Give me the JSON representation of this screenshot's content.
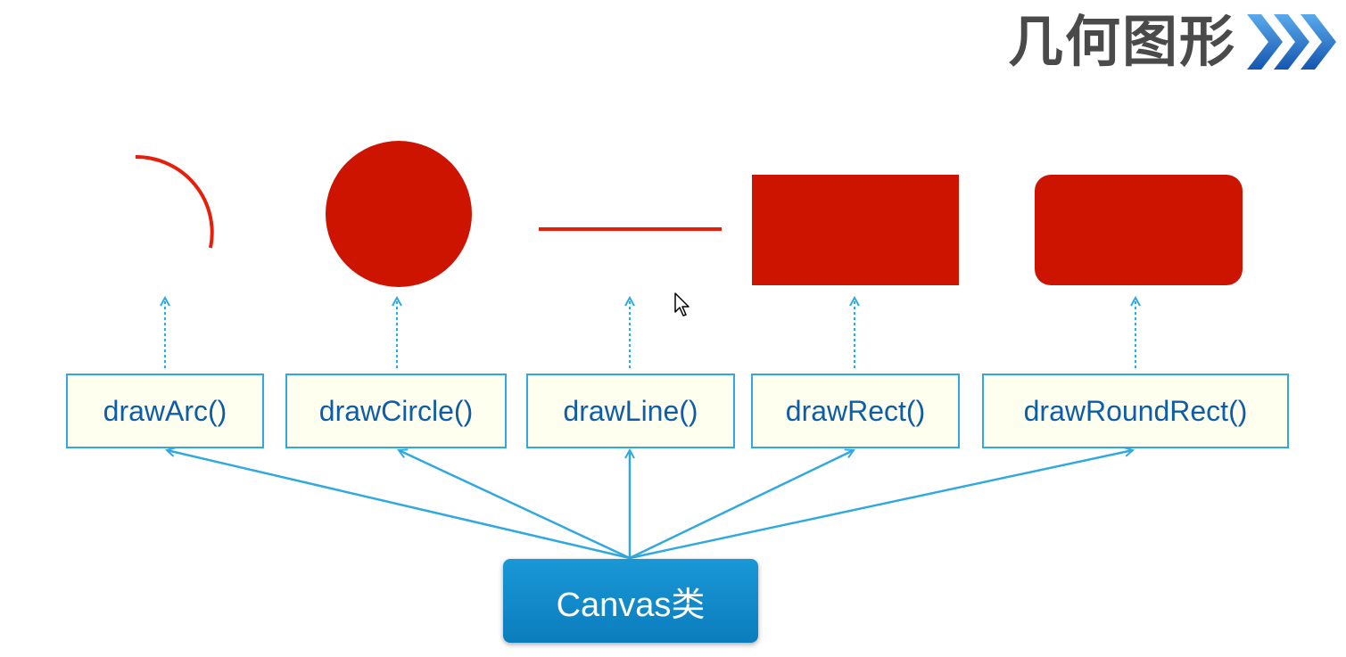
{
  "header": {
    "title": "几何图形"
  },
  "methods": [
    {
      "label": "drawArc()",
      "shape": "arc"
    },
    {
      "label": "drawCircle()",
      "shape": "circle"
    },
    {
      "label": "drawLine()",
      "shape": "line"
    },
    {
      "label": "drawRect()",
      "shape": "rect"
    },
    {
      "label": "drawRoundRect()",
      "shape": "round-rect"
    }
  ],
  "root": {
    "label": "Canvas类"
  },
  "colors": {
    "shape_fill": "#cc1400",
    "shape_stroke": "#e61e0a",
    "connector": "#31a8df",
    "box_border": "#31a8df",
    "box_fill": "#fffff0",
    "method_text": "#0d5da8",
    "root_fill": "#1a8fd0",
    "title_text": "#4a4a4a",
    "chevron": "#1f6fc4"
  },
  "icons": {
    "title_chevrons": "triple-chevron-right-icon",
    "cursor": "mouse-pointer-icon"
  }
}
